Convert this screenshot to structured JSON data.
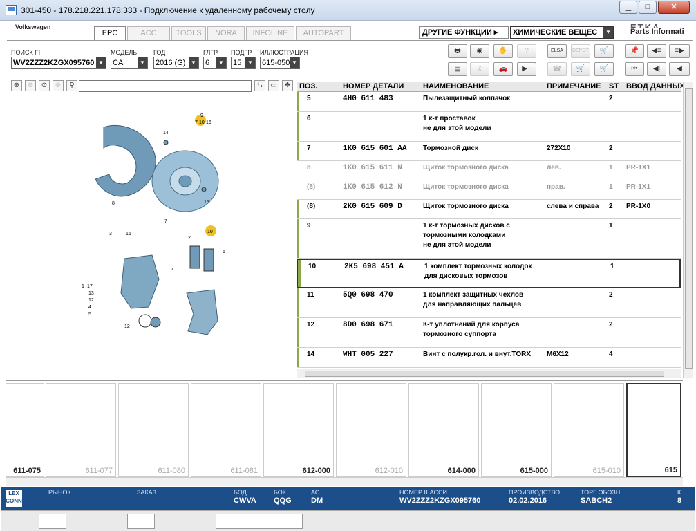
{
  "window": {
    "title": "301-450 - 178.218.221.178:333 - Подключение к удаленному рабочему столу"
  },
  "brand": "Volkswagen",
  "tabs": [
    {
      "label": "EPC",
      "active": true
    },
    {
      "label": "ACC",
      "active": false
    },
    {
      "label": "TOOLS",
      "active": false
    },
    {
      "label": "NORA",
      "active": false
    },
    {
      "label": "INFOLINE",
      "active": false
    },
    {
      "label": "AUTOPART",
      "active": false
    }
  ],
  "functions": {
    "label": "ДРУГИЕ ФУНКЦИИ ▸",
    "selected": "ХИМИЧЕСКИЕ ВЕЩЕС"
  },
  "parts_logo": "Parts Informati",
  "filters": {
    "search_label": "ПОИСК FI",
    "search_value": "WV2ZZZ2KZGX095760",
    "model_label": "МОДЕЛЬ",
    "model_value": "CA",
    "year_label": "ГОД",
    "year_value": "2016 (G)",
    "hg_label": "ГЛГР",
    "hg_value": "6",
    "sg_label": "ПОДГР",
    "sg_value": "15",
    "illus_label": "ИЛЛЮСТРАЦИЯ",
    "illus_value": "615-050"
  },
  "table": {
    "headers": {
      "pos": "ПОЗ.",
      "number": "НОМЕР ДЕТАЛИ",
      "name": "НАИМЕНОВАНИЕ",
      "note": "ПРИМЕЧАНИЕ",
      "st": "ST",
      "date": "ВВОД ДАННЫХ"
    },
    "rows": [
      {
        "pos": "5",
        "number": "4H0 611 483",
        "name": "Пылезащитный колпачок",
        "note": "",
        "st": "2",
        "date": ""
      },
      {
        "pos": "6",
        "number": "",
        "name": "1 к-т проставок\nне для этой модели",
        "note": "",
        "st": "",
        "date": ""
      },
      {
        "pos": "7",
        "number": "1K0 615 601 AA",
        "name": "Тормозной диск",
        "note": "272X10",
        "st": "2",
        "date": ""
      },
      {
        "pos": "8",
        "number": "1K0 615 611 N",
        "name": "Щиток тормозного диска",
        "note": "лев.",
        "st": "1",
        "date": "PR-1X1"
      },
      {
        "pos": "(8)",
        "number": "1K0 615 612 N",
        "name": "Щиток тормозного диска",
        "note": "прав.",
        "st": "1",
        "date": "PR-1X1"
      },
      {
        "pos": "(8)",
        "number": "2K0 615 609 D",
        "name": "Щиток тормозного диска",
        "note": "слева и справа",
        "st": "2",
        "date": "PR-1X0"
      },
      {
        "pos": "9",
        "number": "",
        "name": "1 к-т тормозных дисков с\nтормозными колодками\nне для этой модели",
        "note": "",
        "st": "1",
        "date": ""
      },
      {
        "pos": "10",
        "number": "2K5 698 451 A",
        "name": "1 комплект тормозных колодок\nдля дисковых тормозов",
        "note": "",
        "st": "1",
        "date": ""
      },
      {
        "pos": "11",
        "number": "5Q0 698 470",
        "name": "1 комплект защитных чехлов\nдля направляющих пальцев",
        "note": "",
        "st": "2",
        "date": ""
      },
      {
        "pos": "12",
        "number": "8D0 698 671",
        "name": "К-т уплотнений для корпуса\nтормозного суппорта",
        "note": "",
        "st": "2",
        "date": ""
      },
      {
        "pos": "14",
        "number": "WHT 005 227",
        "name": "Винт с полукр.гол. и внут.TORX",
        "note": "M6X12",
        "st": "4",
        "date": ""
      }
    ]
  },
  "thumbnails": [
    {
      "label": "611-075",
      "active": true
    },
    {
      "label": "611-077",
      "active": false
    },
    {
      "label": "611-080",
      "active": false
    },
    {
      "label": "611-081",
      "active": false
    },
    {
      "label": "612-000",
      "active": true
    },
    {
      "label": "612-010",
      "active": false
    },
    {
      "label": "614-000",
      "active": true
    },
    {
      "label": "615-000",
      "active": true
    },
    {
      "label": "615-010",
      "active": false
    },
    {
      "label": "615",
      "active": true
    }
  ],
  "status": {
    "logo": "LEX\nCONN",
    "market_label": "РЫНОК",
    "market_value": "",
    "order_label": "ЗАКАЗ",
    "order_value": "",
    "body_label": "БОД",
    "body_value": "CWVA",
    "box_label": "БОК",
    "box_value": "QQG",
    "ac_label": "АС",
    "ac_value": "DM",
    "chassis_label": "НОМЕР ШАССИ",
    "chassis_value": "WV2ZZZ2KZGX095760",
    "prod_label": "ПРОИЗВОДСТВО",
    "prod_value": "02.02.2016",
    "trade_label": "ТОРГ ОБОЗН",
    "trade_value": "SABCH2",
    "extra_label": "К",
    "extra_value": "8"
  },
  "diagram_labels": [
    "9",
    "7",
    "10",
    "16",
    "14",
    "8",
    "7",
    "15",
    "10",
    "3",
    "16",
    "2",
    "6",
    "4",
    "1",
    "17",
    "13",
    "12",
    "4",
    "5",
    "12"
  ]
}
